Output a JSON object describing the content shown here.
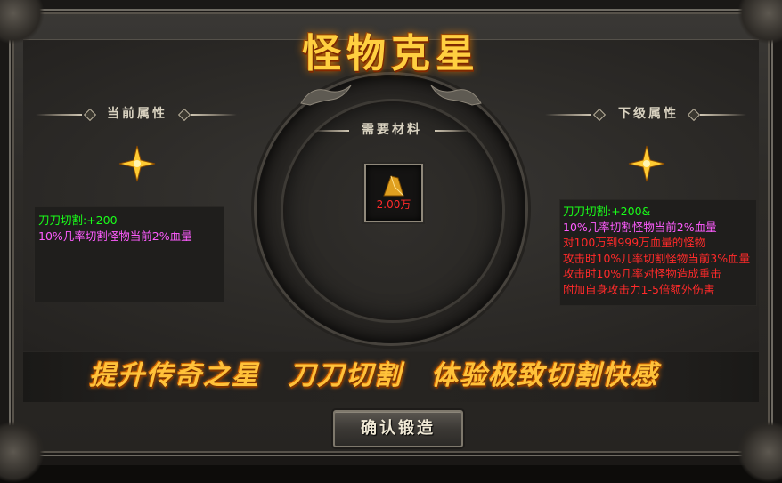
{
  "window": {
    "title": "怪物克星"
  },
  "current_attributes": {
    "heading": "当前属性",
    "lines": [
      {
        "text": "刀刀切割:+200",
        "color": "green"
      },
      {
        "text": "10%几率切割怪物当前2%血量",
        "color": "magenta"
      }
    ]
  },
  "next_attributes": {
    "heading": "下级属性",
    "lines": [
      {
        "text": "刀刀切割:+200&",
        "color": "green"
      },
      {
        "text": "10%几率切割怪物当前2%血量",
        "color": "magenta"
      },
      {
        "text": "对100万到999万血量的怪物",
        "color": "red"
      },
      {
        "text": "攻击时10%几率切割怪物当前3%血量",
        "color": "red"
      },
      {
        "text": "攻击时10%几率对怪物造成重击",
        "color": "red"
      },
      {
        "text": "附加自身攻击力1-5倍额外伤害",
        "color": "red"
      }
    ]
  },
  "materials": {
    "heading": "需要材料",
    "item_icon": "gold-ingot-icon",
    "quantity": "2.00万"
  },
  "banner": {
    "slogan": "提升传奇之星　刀刀切割　体验极致切割快感"
  },
  "actions": {
    "confirm_label": "确认锻造"
  },
  "colors": {
    "green": "#19ff19",
    "magenta": "#ff5cff",
    "red": "#ff2a2a",
    "gold": "#ffc23a"
  }
}
